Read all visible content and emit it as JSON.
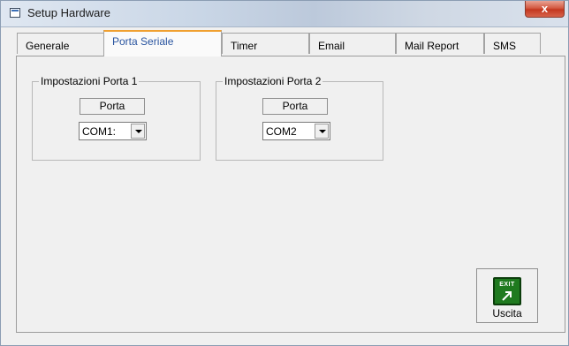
{
  "window": {
    "title": "Setup Hardware",
    "close_symbol": "x"
  },
  "tabs": [
    {
      "label": "Generale",
      "active": false
    },
    {
      "label": "Porta Seriale",
      "active": true
    },
    {
      "label": "Timer",
      "active": false
    },
    {
      "label": "Email",
      "active": false
    },
    {
      "label": "Mail Report",
      "active": false
    },
    {
      "label": "SMS",
      "active": false
    }
  ],
  "groups": [
    {
      "legend": "Impostazioni Porta 1",
      "port_label": "Porta",
      "selected_port": "COM1:"
    },
    {
      "legend": "Impostazioni Porta 2",
      "port_label": "Porta",
      "selected_port": "COM2"
    }
  ],
  "exit_button": {
    "icon_text": "EXIT",
    "label": "Uscita",
    "icon": "exit-arrow-icon"
  },
  "colors": {
    "active_tab_accent": "#f0a030",
    "active_tab_text": "#2a55a0",
    "exit_icon_green": "#1f7a1f",
    "close_button_red": "#c4371f"
  }
}
